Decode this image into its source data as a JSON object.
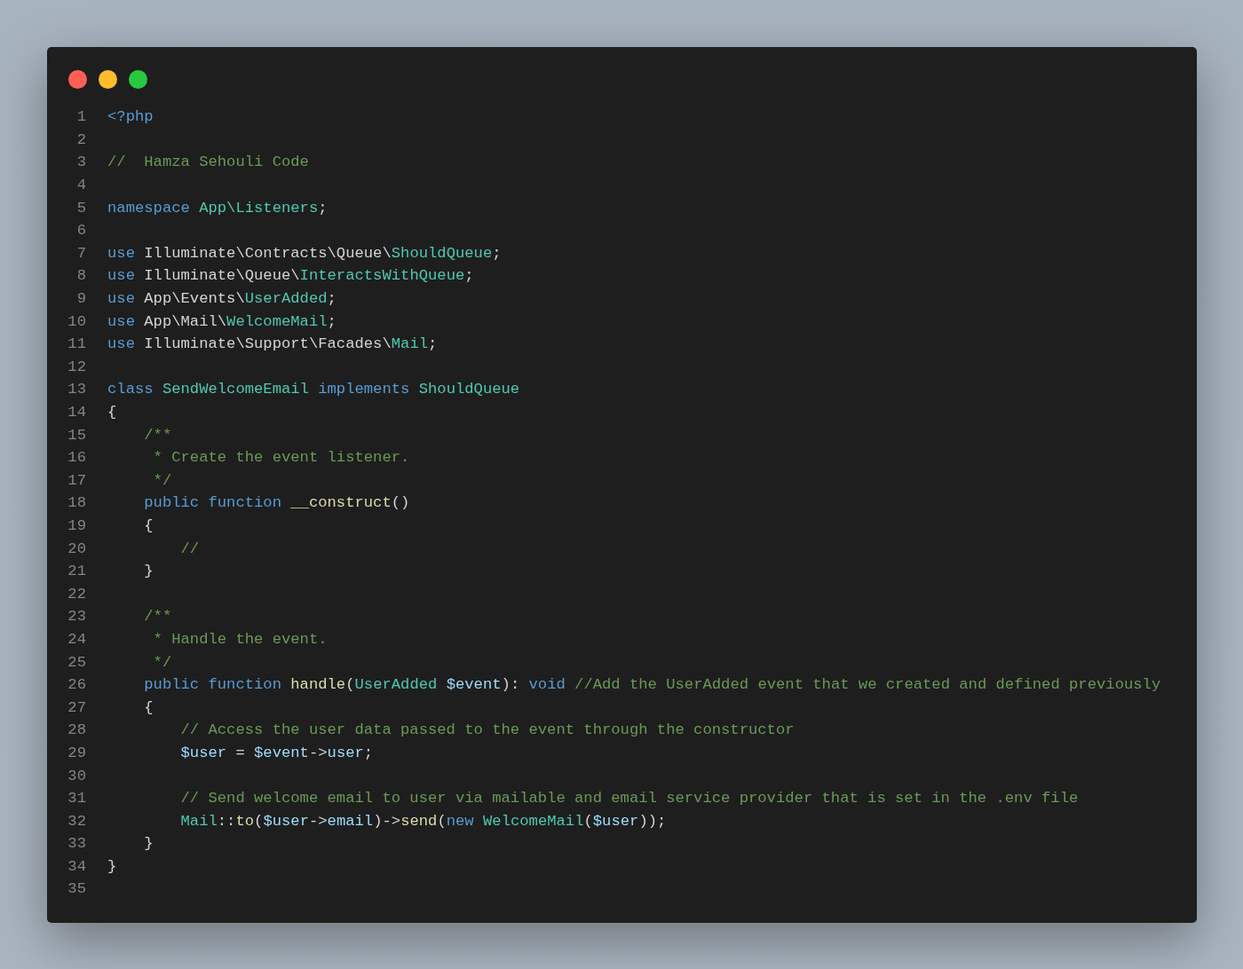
{
  "editor": {
    "lines": [
      {
        "number": "1",
        "tokens": [
          {
            "kind": "keyword",
            "text": "<?php"
          }
        ]
      },
      {
        "number": "2"
      },
      {
        "number": "3",
        "tokens": [
          {
            "kind": "comment",
            "text": "//  Hamza Sehouli Code"
          }
        ]
      },
      {
        "number": "4"
      },
      {
        "number": "5",
        "tokens": [
          {
            "kind": "keyword",
            "text": "namespace "
          },
          {
            "kind": "type",
            "text": "App\\Listeners"
          },
          {
            "kind": "plain",
            "text": ";"
          }
        ]
      },
      {
        "number": "6"
      },
      {
        "number": "7",
        "tokens": [
          {
            "kind": "keyword",
            "text": "use"
          },
          {
            "kind": "plain",
            "text": " Illuminate\\Contracts\\Queue\\"
          },
          {
            "kind": "type",
            "text": "ShouldQueue"
          },
          {
            "kind": "plain",
            "text": ";"
          }
        ]
      },
      {
        "number": "8",
        "tokens": [
          {
            "kind": "keyword",
            "text": "use"
          },
          {
            "kind": "plain",
            "text": " Illuminate\\Queue\\"
          },
          {
            "kind": "type",
            "text": "InteractsWithQueue"
          },
          {
            "kind": "plain",
            "text": ";"
          }
        ]
      },
      {
        "number": "9",
        "tokens": [
          {
            "kind": "keyword",
            "text": "use"
          },
          {
            "kind": "plain",
            "text": " App\\Events\\"
          },
          {
            "kind": "type",
            "text": "UserAdded"
          },
          {
            "kind": "plain",
            "text": ";"
          }
        ]
      },
      {
        "number": "10",
        "tokens": [
          {
            "kind": "keyword",
            "text": "use"
          },
          {
            "kind": "plain",
            "text": " App\\Mail\\"
          },
          {
            "kind": "type",
            "text": "WelcomeMail"
          },
          {
            "kind": "plain",
            "text": ";"
          }
        ]
      },
      {
        "number": "11",
        "tokens": [
          {
            "kind": "keyword",
            "text": "use"
          },
          {
            "kind": "plain",
            "text": " Illuminate\\Support\\Facades\\"
          },
          {
            "kind": "type",
            "text": "Mail"
          },
          {
            "kind": "plain",
            "text": ";"
          }
        ]
      },
      {
        "number": "12"
      },
      {
        "number": "13",
        "tokens": [
          {
            "kind": "keyword",
            "text": "class "
          },
          {
            "kind": "type",
            "text": "SendWelcomeEmail "
          },
          {
            "kind": "keyword",
            "text": "implements "
          },
          {
            "kind": "type",
            "text": "ShouldQueue"
          }
        ]
      },
      {
        "number": "14",
        "tokens": [
          {
            "kind": "plain",
            "text": "{"
          }
        ]
      },
      {
        "number": "15",
        "tokens": [
          {
            "kind": "comment",
            "text": "    /**"
          }
        ]
      },
      {
        "number": "16",
        "tokens": [
          {
            "kind": "comment",
            "text": "     * Create the event listener."
          }
        ]
      },
      {
        "number": "17",
        "tokens": [
          {
            "kind": "comment",
            "text": "     */"
          }
        ]
      },
      {
        "number": "18",
        "tokens": [
          {
            "kind": "keyword",
            "text": "    public "
          },
          {
            "kind": "keyword",
            "text": "function "
          },
          {
            "kind": "function",
            "text": "__construct"
          },
          {
            "kind": "plain",
            "text": "()"
          }
        ]
      },
      {
        "number": "19",
        "tokens": [
          {
            "kind": "plain",
            "text": "    {"
          }
        ]
      },
      {
        "number": "20",
        "tokens": [
          {
            "kind": "comment",
            "text": "        //"
          }
        ]
      },
      {
        "number": "21",
        "tokens": [
          {
            "kind": "plain",
            "text": "    }"
          }
        ]
      },
      {
        "number": "22"
      },
      {
        "number": "23",
        "tokens": [
          {
            "kind": "comment",
            "text": "    /**"
          }
        ]
      },
      {
        "number": "24",
        "tokens": [
          {
            "kind": "comment",
            "text": "     * Handle the event."
          }
        ]
      },
      {
        "number": "25",
        "tokens": [
          {
            "kind": "comment",
            "text": "     */"
          }
        ]
      },
      {
        "number": "26",
        "tokens": [
          {
            "kind": "keyword",
            "text": "    public "
          },
          {
            "kind": "keyword",
            "text": "function "
          },
          {
            "kind": "function",
            "text": "handle"
          },
          {
            "kind": "plain",
            "text": "("
          },
          {
            "kind": "type",
            "text": "UserAdded "
          },
          {
            "kind": "variable",
            "text": "$event"
          },
          {
            "kind": "plain",
            "text": "): "
          },
          {
            "kind": "keyword",
            "text": "void "
          },
          {
            "kind": "comment",
            "text": "//Add the UserAdded event that we created and defined previously"
          }
        ]
      },
      {
        "number": "27",
        "tokens": [
          {
            "kind": "plain",
            "text": "    {"
          }
        ]
      },
      {
        "number": "28",
        "tokens": [
          {
            "kind": "comment",
            "text": "        // Access the user data passed to the event through the constructor"
          }
        ]
      },
      {
        "number": "29",
        "tokens": [
          {
            "kind": "variable",
            "text": "        $user"
          },
          {
            "kind": "plain",
            "text": " = "
          },
          {
            "kind": "variable",
            "text": "$event"
          },
          {
            "kind": "plain",
            "text": "->"
          },
          {
            "kind": "variable",
            "text": "user"
          },
          {
            "kind": "plain",
            "text": ";"
          }
        ]
      },
      {
        "number": "30"
      },
      {
        "number": "31",
        "tokens": [
          {
            "kind": "comment",
            "text": "        // Send welcome email to user via mailable and email service provider that is set in the .env file"
          }
        ]
      },
      {
        "number": "32",
        "tokens": [
          {
            "kind": "type",
            "text": "        Mail"
          },
          {
            "kind": "plain",
            "text": "::"
          },
          {
            "kind": "function",
            "text": "to"
          },
          {
            "kind": "plain",
            "text": "("
          },
          {
            "kind": "variable",
            "text": "$user"
          },
          {
            "kind": "plain",
            "text": "->"
          },
          {
            "kind": "variable",
            "text": "email"
          },
          {
            "kind": "plain",
            "text": ")->"
          },
          {
            "kind": "function",
            "text": "send"
          },
          {
            "kind": "plain",
            "text": "("
          },
          {
            "kind": "keyword",
            "text": "new "
          },
          {
            "kind": "type",
            "text": "WelcomeMail"
          },
          {
            "kind": "plain",
            "text": "("
          },
          {
            "kind": "variable",
            "text": "$user"
          },
          {
            "kind": "plain",
            "text": "));"
          }
        ]
      },
      {
        "number": "33",
        "tokens": [
          {
            "kind": "plain",
            "text": "    }"
          }
        ]
      },
      {
        "number": "34",
        "tokens": [
          {
            "kind": "plain",
            "text": "}"
          }
        ]
      },
      {
        "number": "35"
      }
    ]
  }
}
